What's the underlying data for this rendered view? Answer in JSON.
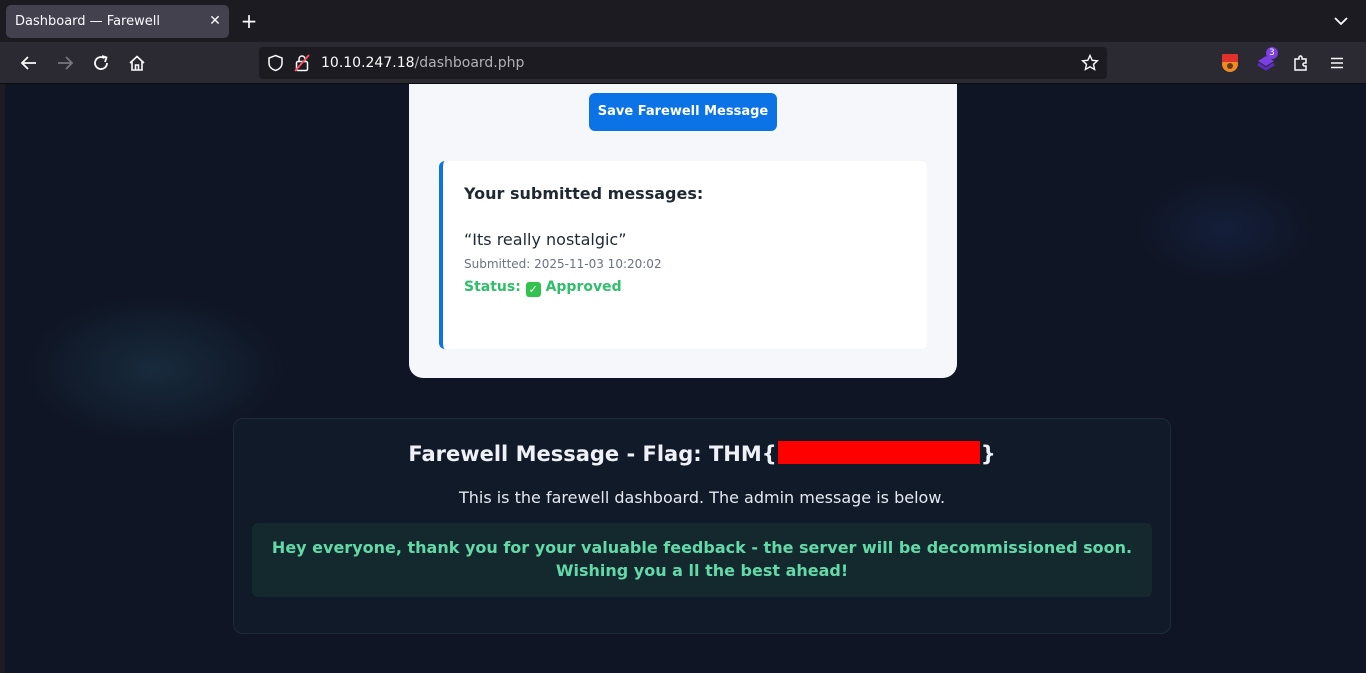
{
  "browser": {
    "tab_title": "Dashboard — Farewell",
    "tab_close": "✕",
    "new_tab": "+",
    "url_host": "10.10.247.18",
    "url_path": "/dashboard.php",
    "extension_badge": "3"
  },
  "card": {
    "save_button": "Save Farewell Message",
    "messages_heading": "Your submitted messages:",
    "message_text": "“Its really nostalgic”",
    "submitted": "Submitted: 2025-11-03 10:20:02",
    "status_label": "Status:",
    "status_value": "Approved",
    "status_icon": "✓"
  },
  "panel": {
    "title_prefix": "Farewell Message - Flag: THM{",
    "title_suffix": "}",
    "subtitle": "This is the farewell dashboard. The admin message is below.",
    "admin_message": "Hey everyone, thank you for your valuable feedback - the server will be decommissioned soon. Wishing you a ll the best ahead!"
  },
  "colors": {
    "accent": "#0b73e6",
    "status_green": "#2fbf6a",
    "admin_text": "#63d9a8",
    "redaction": "#ff0000"
  }
}
